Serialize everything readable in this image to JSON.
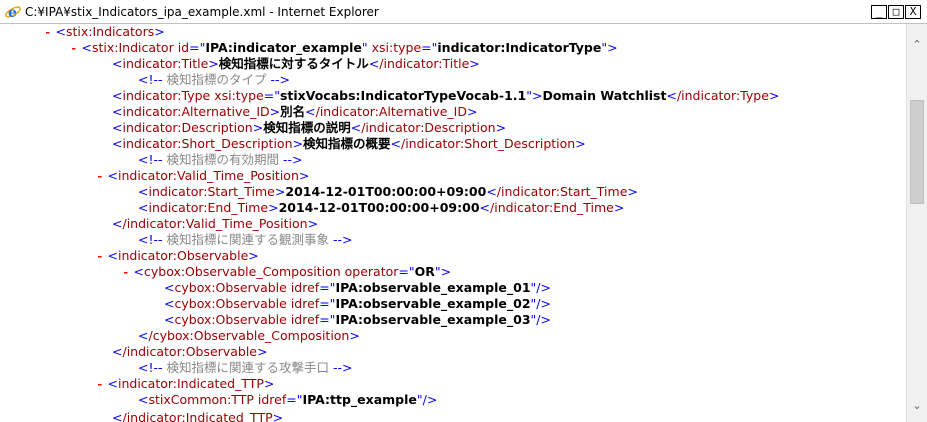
{
  "window": {
    "title": "C:¥IPA¥stix_Indicators_ipa_example.xml - Internet Explorer",
    "buttons": {
      "minimize": "_",
      "maximize": "□",
      "close": "X"
    }
  },
  "xml": {
    "l01": {
      "toggle": "-",
      "tag": "stix:Indicators"
    },
    "l02": {
      "toggle": "-",
      "tag": "stix:Indicator",
      "attr1": "id",
      "val1": "IPA:indicator_example",
      "attr2": "xsi:type",
      "val2": "indicator:IndicatorType"
    },
    "l03": {
      "open": "indicator:Title",
      "text": "検知指標に対するタイトル",
      "close": "/indicator:Title"
    },
    "l04": {
      "comment": "検知指標のタイプ"
    },
    "l05": {
      "open": "indicator:Type",
      "attr": "xsi:type",
      "val": "stixVocabs:IndicatorTypeVocab-1.1",
      "text": "Domain Watchlist",
      "close": "/indicator:Type"
    },
    "l06": {
      "open": "indicator:Alternative_ID",
      "text": "別名",
      "close": "/indicator:Alternative_ID"
    },
    "l07": {
      "open": "indicator:Description",
      "text": "検知指標の説明",
      "close": "/indicator:Description"
    },
    "l08": {
      "open": "indicator:Short_Description",
      "text": "検知指標の概要",
      "close": "/indicator:Short_Description"
    },
    "l09": {
      "comment": "検知指標の有効期間"
    },
    "l10": {
      "toggle": "-",
      "tag": "indicator:Valid_Time_Position"
    },
    "l11": {
      "open": "indicator:Start_Time",
      "text": "2014-12-01T00:00:00+09:00",
      "close": "/indicator:Start_Time"
    },
    "l12": {
      "open": "indicator:End_Time",
      "text": "2014-12-01T00:00:00+09:00",
      "close": "/indicator:End_Time"
    },
    "l13": {
      "tag": "/indicator:Valid_Time_Position"
    },
    "l14": {
      "comment": "検知指標に関連する観測事象"
    },
    "l15": {
      "toggle": "-",
      "tag": "indicator:Observable"
    },
    "l16": {
      "toggle": "-",
      "tag": "cybox:Observable_Composition",
      "attr": "operator",
      "val": "OR"
    },
    "l17": {
      "tag": "cybox:Observable",
      "attr": "idref",
      "val": "IPA:observable_example_01"
    },
    "l18": {
      "tag": "cybox:Observable",
      "attr": "idref",
      "val": "IPA:observable_example_02"
    },
    "l19": {
      "tag": "cybox:Observable",
      "attr": "idref",
      "val": "IPA:observable_example_03"
    },
    "l20": {
      "tag": "/cybox:Observable_Composition"
    },
    "l21": {
      "tag": "/indicator:Observable"
    },
    "l22": {
      "comment": "検知指標に関連する攻撃手口"
    },
    "l23": {
      "toggle": "-",
      "tag": "indicator:Indicated_TTP"
    },
    "l24": {
      "tag": "stixCommon:TTP",
      "attr": "idref",
      "val": "IPA:ttp_example"
    },
    "l25": {
      "tag": "/indicator:Indicated_TTP"
    }
  }
}
